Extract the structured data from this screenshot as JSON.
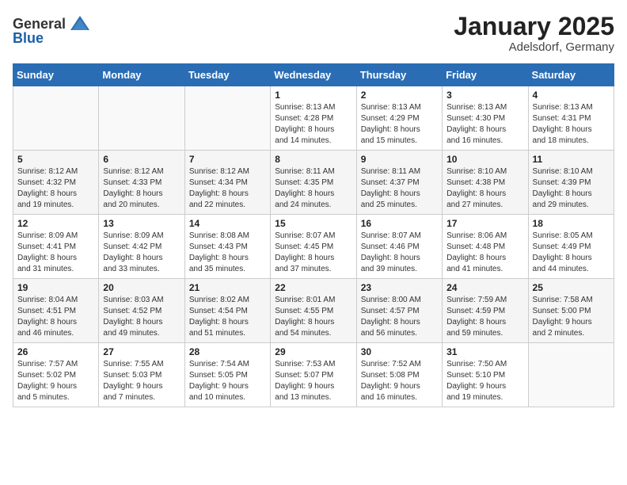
{
  "header": {
    "logo_general": "General",
    "logo_blue": "Blue",
    "month": "January 2025",
    "location": "Adelsdorf, Germany"
  },
  "weekdays": [
    "Sunday",
    "Monday",
    "Tuesday",
    "Wednesday",
    "Thursday",
    "Friday",
    "Saturday"
  ],
  "weeks": [
    [
      {
        "day": "",
        "content": ""
      },
      {
        "day": "",
        "content": ""
      },
      {
        "day": "",
        "content": ""
      },
      {
        "day": "1",
        "content": "Sunrise: 8:13 AM\nSunset: 4:28 PM\nDaylight: 8 hours\nand 14 minutes."
      },
      {
        "day": "2",
        "content": "Sunrise: 8:13 AM\nSunset: 4:29 PM\nDaylight: 8 hours\nand 15 minutes."
      },
      {
        "day": "3",
        "content": "Sunrise: 8:13 AM\nSunset: 4:30 PM\nDaylight: 8 hours\nand 16 minutes."
      },
      {
        "day": "4",
        "content": "Sunrise: 8:13 AM\nSunset: 4:31 PM\nDaylight: 8 hours\nand 18 minutes."
      }
    ],
    [
      {
        "day": "5",
        "content": "Sunrise: 8:12 AM\nSunset: 4:32 PM\nDaylight: 8 hours\nand 19 minutes."
      },
      {
        "day": "6",
        "content": "Sunrise: 8:12 AM\nSunset: 4:33 PM\nDaylight: 8 hours\nand 20 minutes."
      },
      {
        "day": "7",
        "content": "Sunrise: 8:12 AM\nSunset: 4:34 PM\nDaylight: 8 hours\nand 22 minutes."
      },
      {
        "day": "8",
        "content": "Sunrise: 8:11 AM\nSunset: 4:35 PM\nDaylight: 8 hours\nand 24 minutes."
      },
      {
        "day": "9",
        "content": "Sunrise: 8:11 AM\nSunset: 4:37 PM\nDaylight: 8 hours\nand 25 minutes."
      },
      {
        "day": "10",
        "content": "Sunrise: 8:10 AM\nSunset: 4:38 PM\nDaylight: 8 hours\nand 27 minutes."
      },
      {
        "day": "11",
        "content": "Sunrise: 8:10 AM\nSunset: 4:39 PM\nDaylight: 8 hours\nand 29 minutes."
      }
    ],
    [
      {
        "day": "12",
        "content": "Sunrise: 8:09 AM\nSunset: 4:41 PM\nDaylight: 8 hours\nand 31 minutes."
      },
      {
        "day": "13",
        "content": "Sunrise: 8:09 AM\nSunset: 4:42 PM\nDaylight: 8 hours\nand 33 minutes."
      },
      {
        "day": "14",
        "content": "Sunrise: 8:08 AM\nSunset: 4:43 PM\nDaylight: 8 hours\nand 35 minutes."
      },
      {
        "day": "15",
        "content": "Sunrise: 8:07 AM\nSunset: 4:45 PM\nDaylight: 8 hours\nand 37 minutes."
      },
      {
        "day": "16",
        "content": "Sunrise: 8:07 AM\nSunset: 4:46 PM\nDaylight: 8 hours\nand 39 minutes."
      },
      {
        "day": "17",
        "content": "Sunrise: 8:06 AM\nSunset: 4:48 PM\nDaylight: 8 hours\nand 41 minutes."
      },
      {
        "day": "18",
        "content": "Sunrise: 8:05 AM\nSunset: 4:49 PM\nDaylight: 8 hours\nand 44 minutes."
      }
    ],
    [
      {
        "day": "19",
        "content": "Sunrise: 8:04 AM\nSunset: 4:51 PM\nDaylight: 8 hours\nand 46 minutes."
      },
      {
        "day": "20",
        "content": "Sunrise: 8:03 AM\nSunset: 4:52 PM\nDaylight: 8 hours\nand 49 minutes."
      },
      {
        "day": "21",
        "content": "Sunrise: 8:02 AM\nSunset: 4:54 PM\nDaylight: 8 hours\nand 51 minutes."
      },
      {
        "day": "22",
        "content": "Sunrise: 8:01 AM\nSunset: 4:55 PM\nDaylight: 8 hours\nand 54 minutes."
      },
      {
        "day": "23",
        "content": "Sunrise: 8:00 AM\nSunset: 4:57 PM\nDaylight: 8 hours\nand 56 minutes."
      },
      {
        "day": "24",
        "content": "Sunrise: 7:59 AM\nSunset: 4:59 PM\nDaylight: 8 hours\nand 59 minutes."
      },
      {
        "day": "25",
        "content": "Sunrise: 7:58 AM\nSunset: 5:00 PM\nDaylight: 9 hours\nand 2 minutes."
      }
    ],
    [
      {
        "day": "26",
        "content": "Sunrise: 7:57 AM\nSunset: 5:02 PM\nDaylight: 9 hours\nand 5 minutes."
      },
      {
        "day": "27",
        "content": "Sunrise: 7:55 AM\nSunset: 5:03 PM\nDaylight: 9 hours\nand 7 minutes."
      },
      {
        "day": "28",
        "content": "Sunrise: 7:54 AM\nSunset: 5:05 PM\nDaylight: 9 hours\nand 10 minutes."
      },
      {
        "day": "29",
        "content": "Sunrise: 7:53 AM\nSunset: 5:07 PM\nDaylight: 9 hours\nand 13 minutes."
      },
      {
        "day": "30",
        "content": "Sunrise: 7:52 AM\nSunset: 5:08 PM\nDaylight: 9 hours\nand 16 minutes."
      },
      {
        "day": "31",
        "content": "Sunrise: 7:50 AM\nSunset: 5:10 PM\nDaylight: 9 hours\nand 19 minutes."
      },
      {
        "day": "",
        "content": ""
      }
    ]
  ]
}
